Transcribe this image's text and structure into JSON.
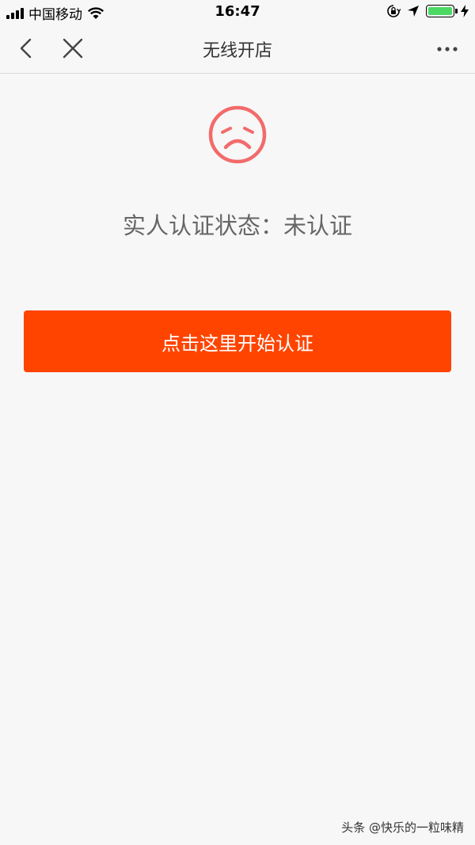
{
  "status_bar": {
    "carrier": "中国移动",
    "time": "16:47",
    "icons": [
      "signal-icon",
      "wifi-icon",
      "orientation-lock-icon",
      "location-icon",
      "battery-icon",
      "charging-icon"
    ],
    "battery_level": 1.0,
    "battery_color": "#4cd964"
  },
  "nav": {
    "title": "无线开店",
    "back_icon": "chevron-left-icon",
    "close_icon": "close-icon",
    "more_icon": "more-icon"
  },
  "main": {
    "status_icon": "sad-face-icon",
    "status_icon_color": "#f26b6b",
    "status_text": "实人认证状态：未认证",
    "button_label": "点击这里开始认证",
    "button_color": "#ff4400"
  },
  "watermark": "头条 @快乐的一粒味精"
}
